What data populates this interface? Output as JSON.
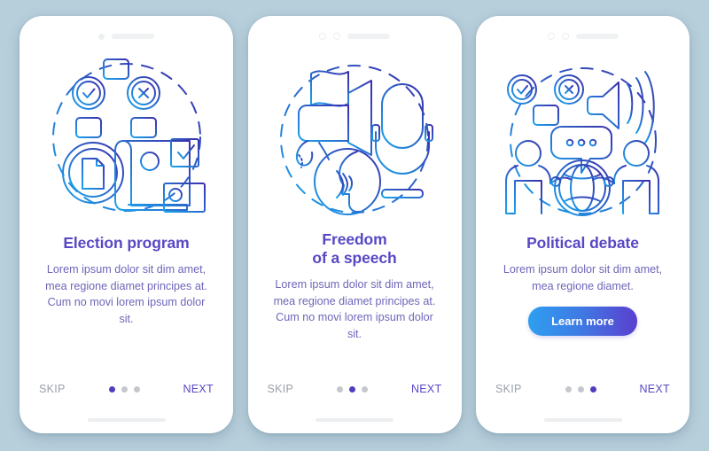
{
  "background_color": "#b7cedb",
  "theme": {
    "title_color": "#5748c4",
    "body_color": "#6d66b9",
    "skip_color": "#9aa0a8",
    "next_color": "#5748c4",
    "dot_active_color": "#4f3fc0",
    "dot_inactive_color": "#c4c7cc",
    "cta_gradient_from": "#2e9ff0",
    "cta_gradient_to": "#5a3fce",
    "illustration_gradient_from": "#1ba3ec",
    "illustration_gradient_to": "#3b2fad"
  },
  "screens": [
    {
      "id": "election-program",
      "illustration_name": "election-program-illustration",
      "title": "Election program",
      "body": "Lorem ipsum dolor sit dim amet, mea regione diamet principes at. Cum no movi lorem ipsum dolor sit.",
      "cta": null,
      "skip_label": "SKIP",
      "next_label": "NEXT",
      "dots": 3,
      "active_dot": 1
    },
    {
      "id": "freedom-of-a-speech",
      "illustration_name": "freedom-of-speech-illustration",
      "title": "Freedom\nof a speech",
      "body": "Lorem ipsum dolor sit dim amet, mea regione diamet principes at. Cum no movi lorem ipsum dolor sit.",
      "cta": null,
      "skip_label": "SKIP",
      "next_label": "NEXT",
      "dots": 3,
      "active_dot": 2
    },
    {
      "id": "political-debate",
      "illustration_name": "political-debate-illustration",
      "title": "Political debate",
      "body": "Lorem ipsum dolor sit dim amet, mea regione diamet.",
      "cta": "Learn more",
      "skip_label": "SKIP",
      "next_label": "NEXT",
      "dots": 3,
      "active_dot": 3
    }
  ],
  "icons": {
    "camera": "camera-dot-icon",
    "speaker": "speaker-slot-icon",
    "home": "home-indicator"
  }
}
